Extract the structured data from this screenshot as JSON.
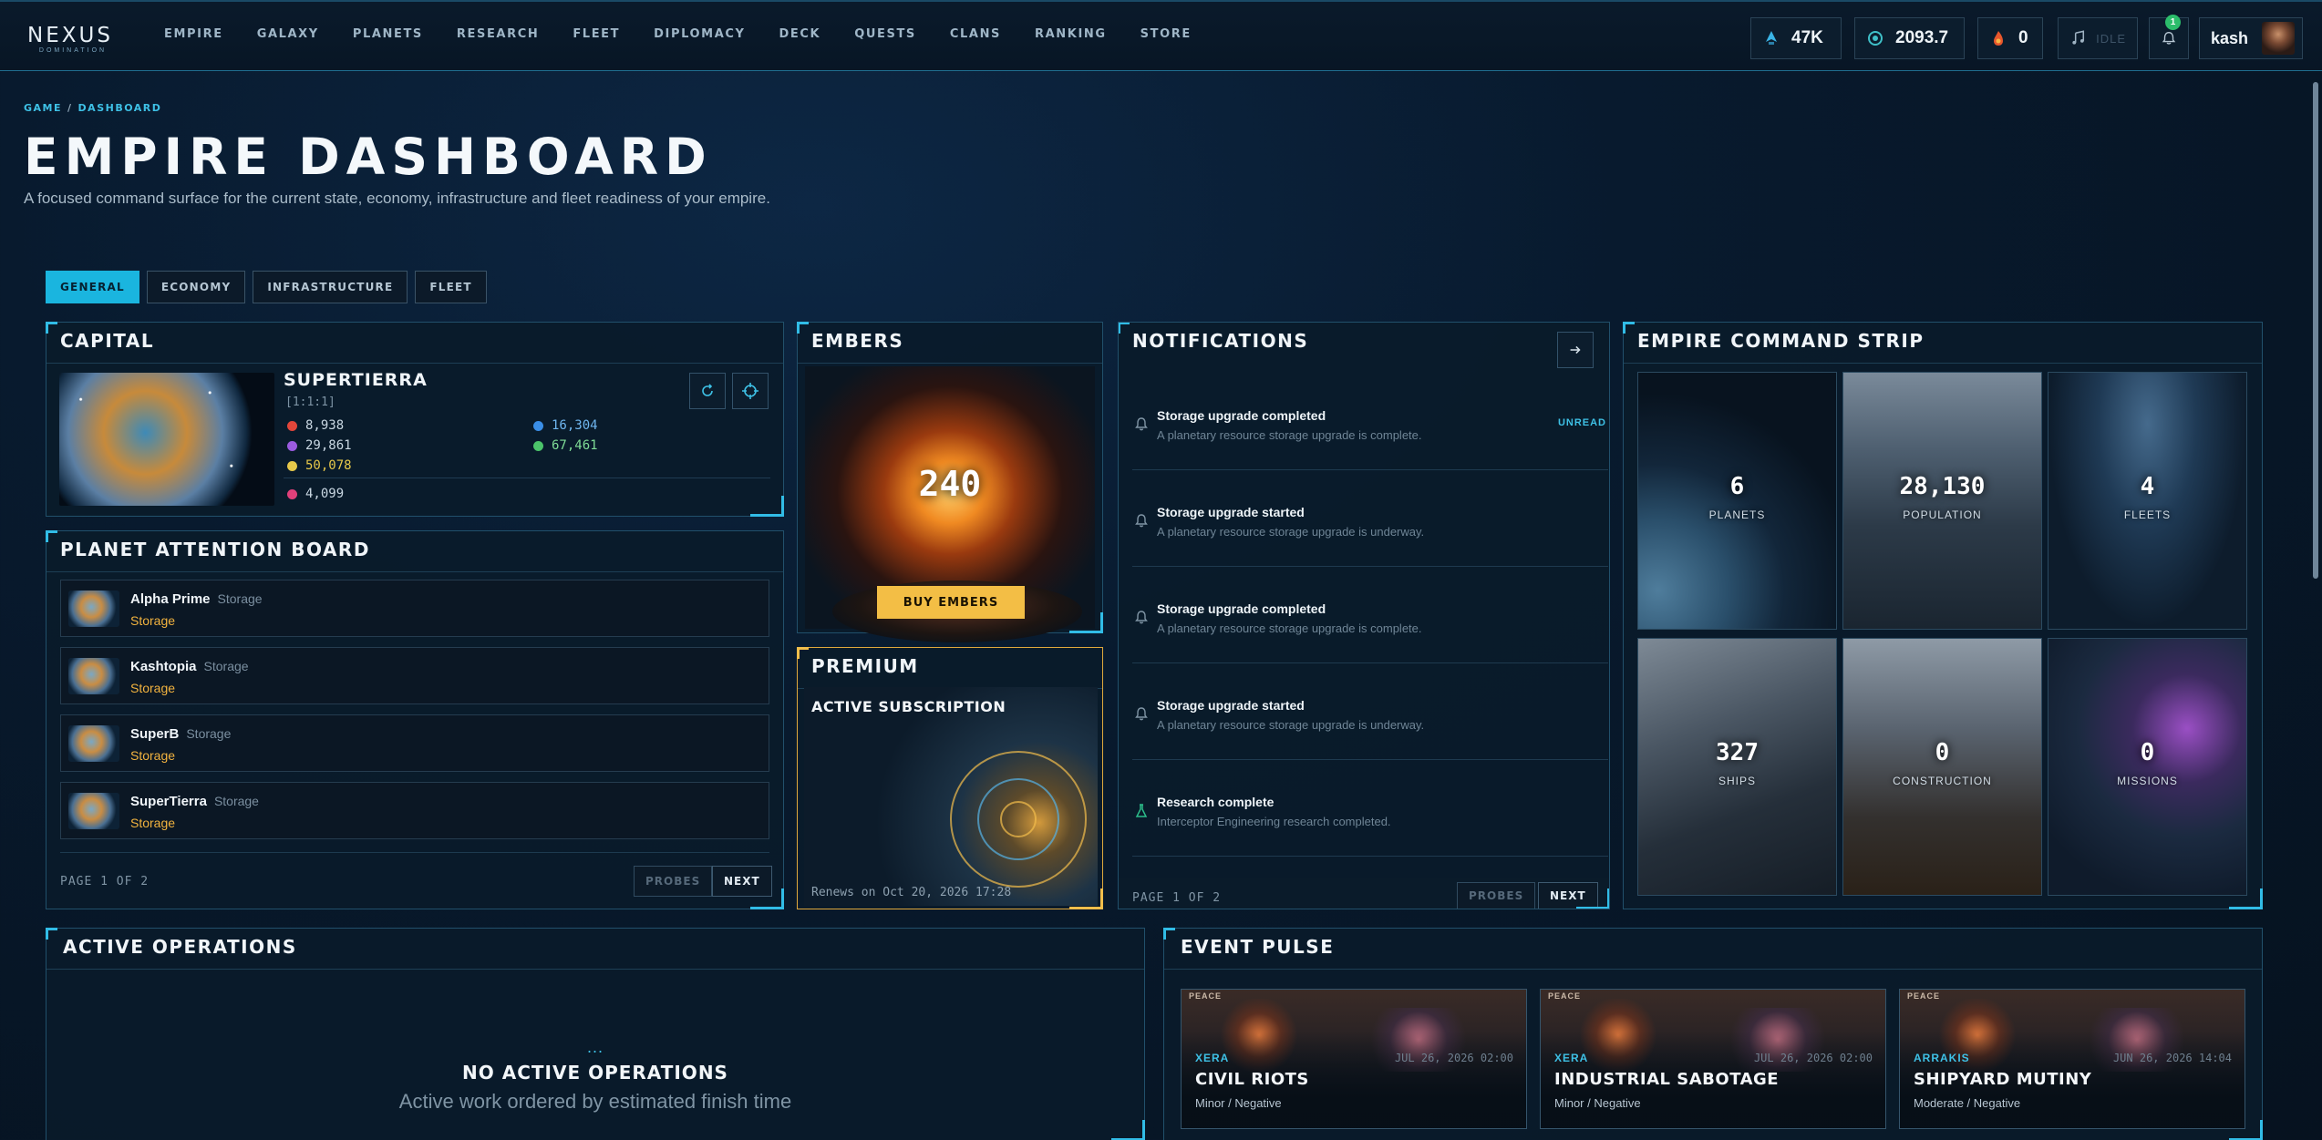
{
  "nav": {
    "logo": "NEXUS",
    "logo_sub": "DOMINATION",
    "links": [
      "EMPIRE",
      "GALAXY",
      "PLANETS",
      "RESEARCH",
      "FLEET",
      "DIPLOMACY",
      "DECK",
      "QUESTS",
      "CLANS",
      "RANKING",
      "STORE"
    ],
    "stats": {
      "ships": "47K",
      "credits": "2093.7",
      "embers": "0"
    },
    "music": {
      "icon": "music-note-icon",
      "status": "IDLE"
    },
    "notifications": {
      "icon": "bell-icon",
      "badge": "1"
    },
    "user": "kash"
  },
  "breadcrumb": {
    "root": "GAME",
    "sep": "/",
    "current": "DASHBOARD"
  },
  "page": {
    "title": "EMPIRE DASHBOARD",
    "subtitle": "A focused command surface for the current state, economy, infrastructure and fleet readiness of your empire."
  },
  "tabs": [
    "GENERAL",
    "ECONOMY",
    "INFRASTRUCTURE",
    "FLEET"
  ],
  "active_tab": "GENERAL",
  "capital": {
    "heading": "CAPITAL",
    "name": "SUPERTIERRA",
    "coords": "[1:1:1]",
    "resources": [
      {
        "value": "8,938",
        "color": "#e2463a"
      },
      {
        "value": "29,861",
        "color": "#9b5be0"
      },
      {
        "value": "50,078",
        "color": "#e6c84a"
      },
      {
        "value": "16,304",
        "color": "#3a8ee6"
      },
      {
        "value": "67,461",
        "color": "#4bc46a"
      },
      {
        "value": "4,099",
        "color": "#e0407a"
      }
    ]
  },
  "attention": {
    "heading": "PLANET ATTENTION BOARD",
    "items": [
      {
        "name": "Alpha Prime",
        "tag": "Storage",
        "status": "Storage"
      },
      {
        "name": "Kashtopia",
        "tag": "Storage",
        "status": "Storage"
      },
      {
        "name": "SuperB",
        "tag": "Storage",
        "status": "Storage"
      },
      {
        "name": "SuperTierra",
        "tag": "Storage",
        "status": "Storage"
      }
    ],
    "page": "PAGE 1 OF 2",
    "prev": "PROBES",
    "next": "NEXT"
  },
  "embers": {
    "heading": "EMBERS",
    "value": "240",
    "buy": "BUY EMBERS"
  },
  "premium": {
    "heading": "PREMIUM",
    "status": "ACTIVE SUBSCRIPTION",
    "renews": "Renews on Oct 20, 2026 17:28"
  },
  "notifications": {
    "heading": "NOTIFICATIONS",
    "items": [
      {
        "title": "Storage upgrade completed",
        "desc": "A planetary resource storage upgrade is complete.",
        "unread": "UNREAD"
      },
      {
        "title": "Storage upgrade started",
        "desc": "A planetary resource storage upgrade is underway.",
        "unread": ""
      },
      {
        "title": "Storage upgrade completed",
        "desc": "A planetary resource storage upgrade is complete.",
        "unread": ""
      },
      {
        "title": "Storage upgrade started",
        "desc": "A planetary resource storage upgrade is underway.",
        "unread": ""
      },
      {
        "title": "Research complete",
        "desc": "Interceptor Engineering research completed.",
        "unread": ""
      }
    ],
    "page": "PAGE 1 OF 2",
    "prev": "PROBES",
    "next": "NEXT"
  },
  "command_strip": {
    "heading": "EMPIRE COMMAND STRIP",
    "tiles": [
      {
        "value": "6",
        "label": "PLANETS"
      },
      {
        "value": "28,130",
        "label": "POPULATION"
      },
      {
        "value": "4",
        "label": "FLEETS"
      },
      {
        "value": "327",
        "label": "SHIPS"
      },
      {
        "value": "0",
        "label": "CONSTRUCTION"
      },
      {
        "value": "0",
        "label": "MISSIONS"
      }
    ]
  },
  "operations": {
    "heading": "ACTIVE OPERATIONS",
    "dots": "...",
    "empty": "NO ACTIVE OPERATIONS",
    "desc": "Active work ordered by estimated finish time"
  },
  "events": {
    "heading": "EVENT PULSE",
    "items": [
      {
        "location": "XERA",
        "date": "JUL 26, 2026 02:00",
        "title": "CIVIL RIOTS",
        "severity": "Minor / Negative",
        "peace": "PEACE"
      },
      {
        "location": "XERA",
        "date": "JUL 26, 2026 02:00",
        "title": "INDUSTRIAL SABOTAGE",
        "severity": "Minor / Negative",
        "peace": "PEACE"
      },
      {
        "location": "ARRAKIS",
        "date": "JUN 26, 2026 14:04",
        "title": "SHIPYARD MUTINY",
        "severity": "Moderate / Negative",
        "peace": "PEACE"
      }
    ]
  }
}
